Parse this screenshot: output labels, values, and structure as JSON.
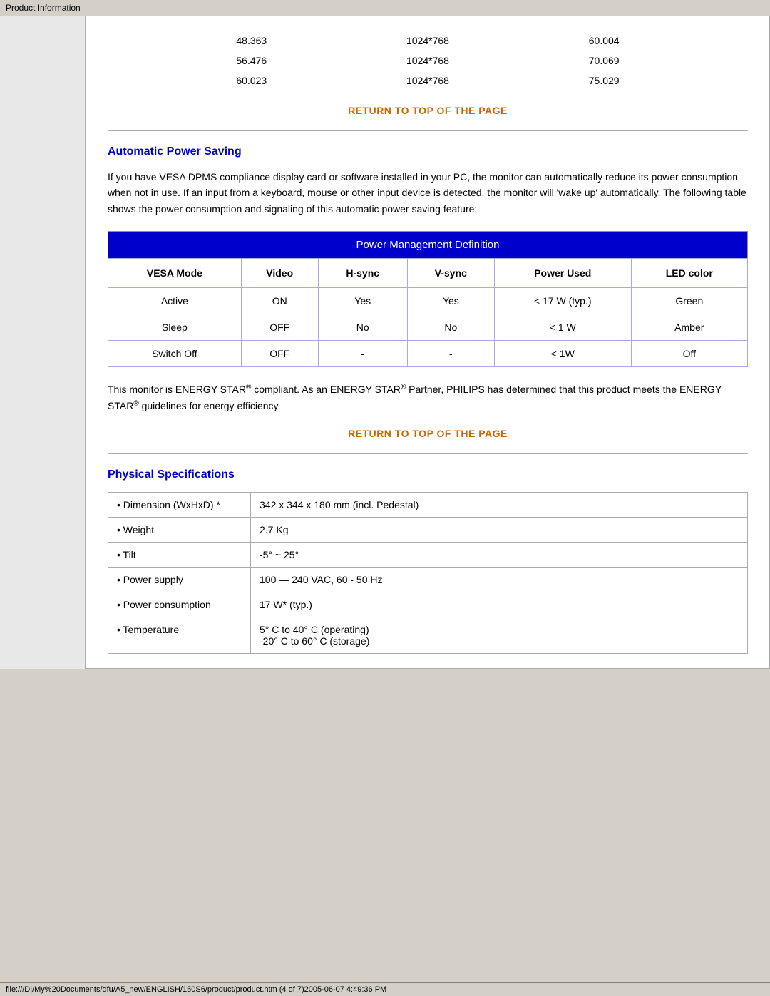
{
  "titleBar": {
    "label": "Product Information"
  },
  "resolutionRows": [
    {
      "col1": "48.363",
      "col2": "1024*768",
      "col3": "60.004"
    },
    {
      "col1": "56.476",
      "col2": "1024*768",
      "col3": "70.069"
    },
    {
      "col1": "60.023",
      "col2": "1024*768",
      "col3": "75.029"
    }
  ],
  "returnLink": "RETURN TO TOP OF THE PAGE",
  "sections": {
    "powerSaving": {
      "title": "Automatic Power Saving",
      "description": "If you have VESA DPMS compliance display card or software installed in your PC, the monitor can automatically reduce its power consumption when not in use. If an input from a keyboard, mouse or other input device is detected, the monitor will 'wake up' automatically. The following table shows the power consumption and signaling of this automatic power saving feature:",
      "tableTitle": "Power Management Definition",
      "columns": [
        "VESA Mode",
        "Video",
        "H-sync",
        "V-sync",
        "Power Used",
        "LED color"
      ],
      "rows": [
        [
          "Active",
          "ON",
          "Yes",
          "Yes",
          "< 17 W (typ.)",
          "Green"
        ],
        [
          "Sleep",
          "OFF",
          "No",
          "No",
          "< 1 W",
          "Amber"
        ],
        [
          "Switch Off",
          "OFF",
          "-",
          "-",
          "< 1W",
          "Off"
        ]
      ],
      "energyStarText": "This monitor is ENERGY STAR® compliant. As an ENERGY STAR® Partner, PHILIPS has determined that this product meets the ENERGY STAR® guidelines for energy efficiency."
    },
    "physicalSpecs": {
      "title": "Physical Specifications",
      "rows": [
        {
          "label": "• Dimension (WxHxD) *",
          "value": "342 x 344 x 180 mm (incl. Pedestal)"
        },
        {
          "label": "• Weight",
          "value": "2.7 Kg"
        },
        {
          "label": "• Tilt",
          "value": "-5° ~ 25°"
        },
        {
          "label": "• Power supply",
          "value": "100 — 240 VAC, 60 - 50 Hz"
        },
        {
          "label": "• Power consumption",
          "value": "17 W* (typ.)"
        },
        {
          "label": "• Temperature",
          "value": "5° C to 40° C (operating)\n-20° C to 60° C (storage)"
        }
      ]
    }
  },
  "statusBar": {
    "text": "file:///D|/My%20Documents/dfu/A5_new/ENGLISH/150S6/product/product.htm (4 of 7)2005-06-07 4:49:36 PM"
  }
}
